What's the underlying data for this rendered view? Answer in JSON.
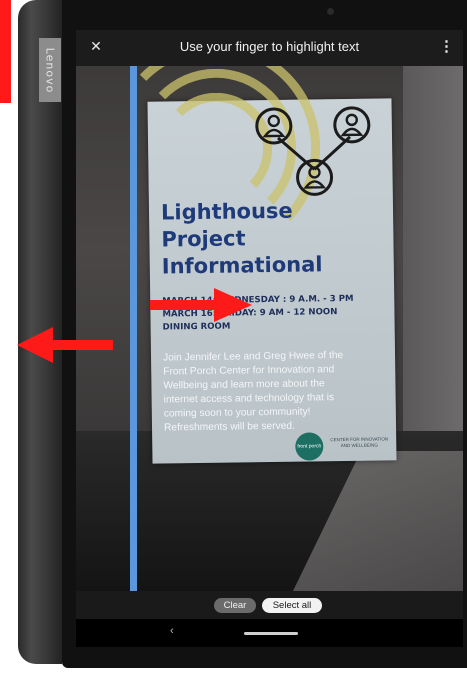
{
  "device": {
    "brand": "Lenovo"
  },
  "topbar": {
    "close_icon": "✕",
    "title": "Use your finger to highlight text",
    "menu_icon": "⋮"
  },
  "poster": {
    "title": [
      "Lighthouse",
      "Project",
      "Informational"
    ],
    "dates": [
      "MARCH 14: WEDNESDAY : 9 A.M. - 3 PM",
      "MARCH 16: FRIDAY: 9 AM - 12 NOON",
      "DINING ROOM"
    ],
    "body": "Join Jennifer Lee and Greg Hwee of the Front Porch Center for Innovation and Wellbeing and learn more about the internet access and technology that is coming soon to your community! Refreshments will be served.",
    "logo_text": "front porch",
    "logo_caption": "CENTER FOR INNOVATION AND WELLBEING"
  },
  "actions": {
    "clear_label": "Clear",
    "select_all_label": "Select all"
  },
  "navigation": {
    "back_icon": "‹"
  },
  "colors": {
    "highlight": "#5b97dc",
    "annotation_red": "#ff1a1a",
    "poster_title": "#1e3a78"
  }
}
